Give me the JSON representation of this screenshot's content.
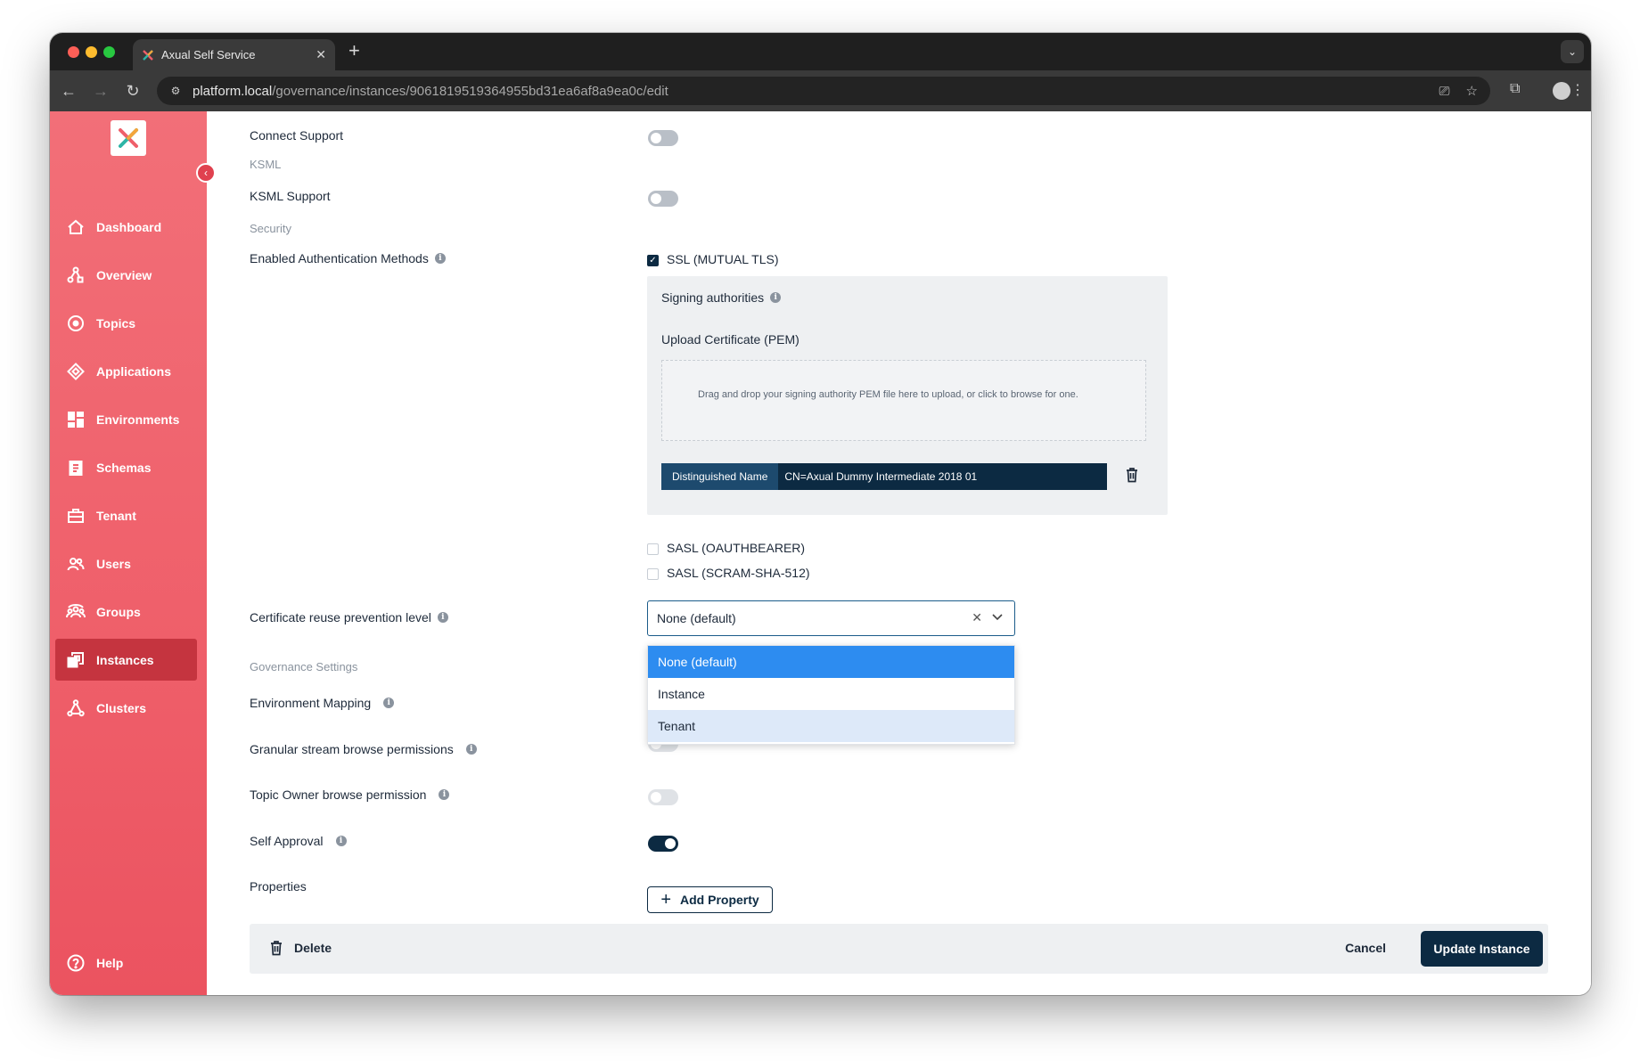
{
  "browser": {
    "tab_title": "Axual Self Service",
    "url_host": "platform.local",
    "url_path": "/governance/instances/9061819519364955bd31ea6af8a9ea0c/edit"
  },
  "sidebar": {
    "items": [
      {
        "label": "Dashboard",
        "icon": "home-icon"
      },
      {
        "label": "Overview",
        "icon": "overview-icon"
      },
      {
        "label": "Topics",
        "icon": "topics-icon"
      },
      {
        "label": "Applications",
        "icon": "applications-icon"
      },
      {
        "label": "Environments",
        "icon": "environments-icon"
      },
      {
        "label": "Schemas",
        "icon": "schemas-icon"
      },
      {
        "label": "Tenant",
        "icon": "tenant-icon"
      },
      {
        "label": "Users",
        "icon": "users-icon"
      },
      {
        "label": "Groups",
        "icon": "groups-icon"
      },
      {
        "label": "Instances",
        "icon": "instances-icon",
        "active": true
      },
      {
        "label": "Clusters",
        "icon": "clusters-icon"
      }
    ],
    "help": "Help"
  },
  "form": {
    "connect_support": "Connect Support",
    "ksml_section": "KSML",
    "ksml_support": "KSML Support",
    "security_section": "Security",
    "auth_methods": "Enabled Authentication Methods",
    "ssl_option": "SSL (MUTUAL TLS)",
    "signing_authorities": "Signing authorities",
    "upload_cert": "Upload Certificate (PEM)",
    "dropzone_text": "Drag and drop your signing authority PEM file here to upload, or click to browse for one.",
    "dn_key": "Distinguished Name",
    "dn_value": "CN=Axual Dummy Intermediate 2018 01",
    "sasl_oauth": "SASL (OAUTHBEARER)",
    "sasl_scram": "SASL (SCRAM-SHA-512)",
    "cert_reuse": "Certificate reuse prevention level",
    "cert_reuse_value": "None (default)",
    "cert_reuse_options": [
      "None (default)",
      "Instance",
      "Tenant"
    ],
    "governance_section": "Governance Settings",
    "env_mapping": "Environment Mapping",
    "granular_browse": "Granular stream browse permissions",
    "topic_owner_browse": "Topic Owner browse permission",
    "self_approval": "Self Approval",
    "properties": "Properties",
    "add_property": "Add Property"
  },
  "footer": {
    "delete": "Delete",
    "cancel": "Cancel",
    "update": "Update Instance"
  },
  "colors": {
    "sidebar": "#ef5f6a",
    "sidebar_active": "#c5343f",
    "primary": "#0c2a42",
    "select_highlight": "#2d8cf0"
  }
}
